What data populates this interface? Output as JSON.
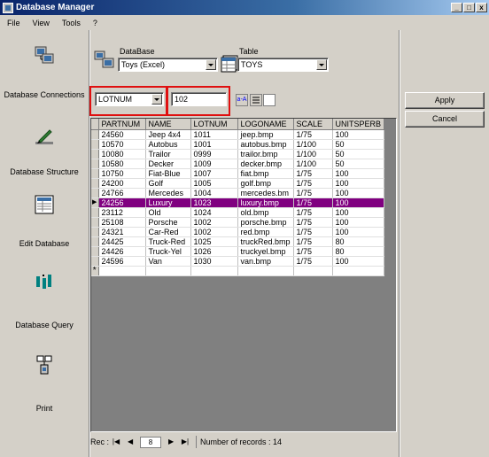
{
  "window": {
    "title": "Database Manager",
    "controls": [
      "_",
      "□",
      "x"
    ]
  },
  "menu": [
    {
      "label": "File",
      "ul": "F"
    },
    {
      "label": "View",
      "ul": "V"
    },
    {
      "label": "Tools",
      "ul": "T"
    },
    {
      "label": "?",
      "ul": ""
    }
  ],
  "sidebar": {
    "items": [
      {
        "label": "Database Connections",
        "icon": "database-connections-icon"
      },
      {
        "label": "Database Structure",
        "icon": "database-structure-icon"
      },
      {
        "label": "Edit Database",
        "icon": "edit-database-icon"
      },
      {
        "label": "Database Query",
        "icon": "database-query-icon"
      },
      {
        "label": "Print",
        "icon": "print-icon"
      }
    ]
  },
  "header": {
    "database_label": "DataBase",
    "database_value": "Toys (Excel)",
    "table_label": "Table",
    "table_value": "TOYS"
  },
  "filter": {
    "field_value": "LOTNUM",
    "search_value": "102"
  },
  "grid": {
    "columns": [
      "PARTNUM",
      "NAME",
      "LOTNUM",
      "LOGONAME",
      "SCALE",
      "UNITSPERB"
    ],
    "rows": [
      [
        "24560",
        "Jeep 4x4",
        "1011",
        "jeep.bmp",
        "1/75",
        "100"
      ],
      [
        "10570",
        "Autobus",
        "1001",
        "autobus.bmp",
        "1/100",
        "50"
      ],
      [
        "10080",
        "Trailor",
        "0999",
        "trailor.bmp",
        "1/100",
        "50"
      ],
      [
        "10580",
        "Decker",
        "1009",
        "decker.bmp",
        "1/100",
        "50"
      ],
      [
        "10750",
        "Fiat-Blue",
        "1007",
        "fiat.bmp",
        "1/75",
        "100"
      ],
      [
        "24200",
        "Golf",
        "1005",
        "golf.bmp",
        "1/75",
        "100"
      ],
      [
        "24766",
        "Mercedes",
        "1004",
        "mercedes.bm",
        "1/75",
        "100"
      ],
      [
        "24256",
        "Luxury",
        "1023",
        "luxury.bmp",
        "1/75",
        "100"
      ],
      [
        "23112",
        "Old",
        "1024",
        "old.bmp",
        "1/75",
        "100"
      ],
      [
        "25108",
        "Porsche",
        "1002",
        "porsche.bmp",
        "1/75",
        "100"
      ],
      [
        "24321",
        "Car-Red",
        "1002",
        "red.bmp",
        "1/75",
        "100"
      ],
      [
        "24425",
        "Truck-Red",
        "1025",
        "truckRed.bmp",
        "1/75",
        "80"
      ],
      [
        "24426",
        "Truck-Yel",
        "1026",
        "truckyel.bmp",
        "1/75",
        "80"
      ],
      [
        "24596",
        "Van",
        "1030",
        "van.bmp",
        "1/75",
        "100"
      ]
    ],
    "selected_row": 7,
    "new_row_marker": "*",
    "current_marker": "▶"
  },
  "nav": {
    "rec_label": "Rec :",
    "rec_value": "8",
    "record_count_text": "Number of records : 14"
  },
  "buttons": {
    "apply": "Apply",
    "cancel": "Cancel"
  }
}
